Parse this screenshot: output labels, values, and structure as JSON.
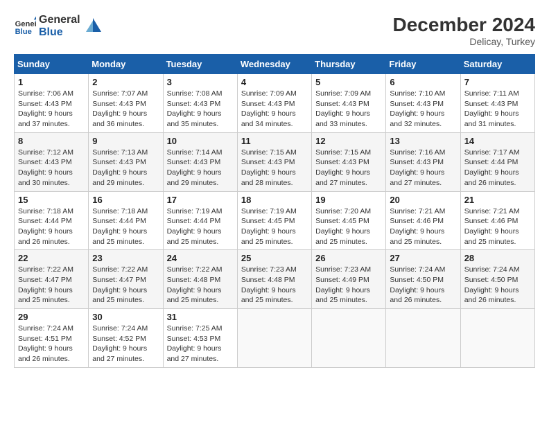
{
  "header": {
    "logo_text_general": "General",
    "logo_text_blue": "Blue",
    "month_year": "December 2024",
    "location": "Delicay, Turkey"
  },
  "days_of_week": [
    "Sunday",
    "Monday",
    "Tuesday",
    "Wednesday",
    "Thursday",
    "Friday",
    "Saturday"
  ],
  "weeks": [
    [
      {
        "day": "1",
        "sunrise": "7:06 AM",
        "sunset": "4:43 PM",
        "daylight": "9 hours and 37 minutes."
      },
      {
        "day": "2",
        "sunrise": "7:07 AM",
        "sunset": "4:43 PM",
        "daylight": "9 hours and 36 minutes."
      },
      {
        "day": "3",
        "sunrise": "7:08 AM",
        "sunset": "4:43 PM",
        "daylight": "9 hours and 35 minutes."
      },
      {
        "day": "4",
        "sunrise": "7:09 AM",
        "sunset": "4:43 PM",
        "daylight": "9 hours and 34 minutes."
      },
      {
        "day": "5",
        "sunrise": "7:09 AM",
        "sunset": "4:43 PM",
        "daylight": "9 hours and 33 minutes."
      },
      {
        "day": "6",
        "sunrise": "7:10 AM",
        "sunset": "4:43 PM",
        "daylight": "9 hours and 32 minutes."
      },
      {
        "day": "7",
        "sunrise": "7:11 AM",
        "sunset": "4:43 PM",
        "daylight": "9 hours and 31 minutes."
      }
    ],
    [
      {
        "day": "8",
        "sunrise": "7:12 AM",
        "sunset": "4:43 PM",
        "daylight": "9 hours and 30 minutes."
      },
      {
        "day": "9",
        "sunrise": "7:13 AM",
        "sunset": "4:43 PM",
        "daylight": "9 hours and 29 minutes."
      },
      {
        "day": "10",
        "sunrise": "7:14 AM",
        "sunset": "4:43 PM",
        "daylight": "9 hours and 29 minutes."
      },
      {
        "day": "11",
        "sunrise": "7:15 AM",
        "sunset": "4:43 PM",
        "daylight": "9 hours and 28 minutes."
      },
      {
        "day": "12",
        "sunrise": "7:15 AM",
        "sunset": "4:43 PM",
        "daylight": "9 hours and 27 minutes."
      },
      {
        "day": "13",
        "sunrise": "7:16 AM",
        "sunset": "4:43 PM",
        "daylight": "9 hours and 27 minutes."
      },
      {
        "day": "14",
        "sunrise": "7:17 AM",
        "sunset": "4:44 PM",
        "daylight": "9 hours and 26 minutes."
      }
    ],
    [
      {
        "day": "15",
        "sunrise": "7:18 AM",
        "sunset": "4:44 PM",
        "daylight": "9 hours and 26 minutes."
      },
      {
        "day": "16",
        "sunrise": "7:18 AM",
        "sunset": "4:44 PM",
        "daylight": "9 hours and 25 minutes."
      },
      {
        "day": "17",
        "sunrise": "7:19 AM",
        "sunset": "4:44 PM",
        "daylight": "9 hours and 25 minutes."
      },
      {
        "day": "18",
        "sunrise": "7:19 AM",
        "sunset": "4:45 PM",
        "daylight": "9 hours and 25 minutes."
      },
      {
        "day": "19",
        "sunrise": "7:20 AM",
        "sunset": "4:45 PM",
        "daylight": "9 hours and 25 minutes."
      },
      {
        "day": "20",
        "sunrise": "7:21 AM",
        "sunset": "4:46 PM",
        "daylight": "9 hours and 25 minutes."
      },
      {
        "day": "21",
        "sunrise": "7:21 AM",
        "sunset": "4:46 PM",
        "daylight": "9 hours and 25 minutes."
      }
    ],
    [
      {
        "day": "22",
        "sunrise": "7:22 AM",
        "sunset": "4:47 PM",
        "daylight": "9 hours and 25 minutes."
      },
      {
        "day": "23",
        "sunrise": "7:22 AM",
        "sunset": "4:47 PM",
        "daylight": "9 hours and 25 minutes."
      },
      {
        "day": "24",
        "sunrise": "7:22 AM",
        "sunset": "4:48 PM",
        "daylight": "9 hours and 25 minutes."
      },
      {
        "day": "25",
        "sunrise": "7:23 AM",
        "sunset": "4:48 PM",
        "daylight": "9 hours and 25 minutes."
      },
      {
        "day": "26",
        "sunrise": "7:23 AM",
        "sunset": "4:49 PM",
        "daylight": "9 hours and 25 minutes."
      },
      {
        "day": "27",
        "sunrise": "7:24 AM",
        "sunset": "4:50 PM",
        "daylight": "9 hours and 26 minutes."
      },
      {
        "day": "28",
        "sunrise": "7:24 AM",
        "sunset": "4:50 PM",
        "daylight": "9 hours and 26 minutes."
      }
    ],
    [
      {
        "day": "29",
        "sunrise": "7:24 AM",
        "sunset": "4:51 PM",
        "daylight": "9 hours and 26 minutes."
      },
      {
        "day": "30",
        "sunrise": "7:24 AM",
        "sunset": "4:52 PM",
        "daylight": "9 hours and 27 minutes."
      },
      {
        "day": "31",
        "sunrise": "7:25 AM",
        "sunset": "4:53 PM",
        "daylight": "9 hours and 27 minutes."
      },
      null,
      null,
      null,
      null
    ]
  ],
  "labels": {
    "sunrise": "Sunrise:",
    "sunset": "Sunset:",
    "daylight": "Daylight:"
  }
}
